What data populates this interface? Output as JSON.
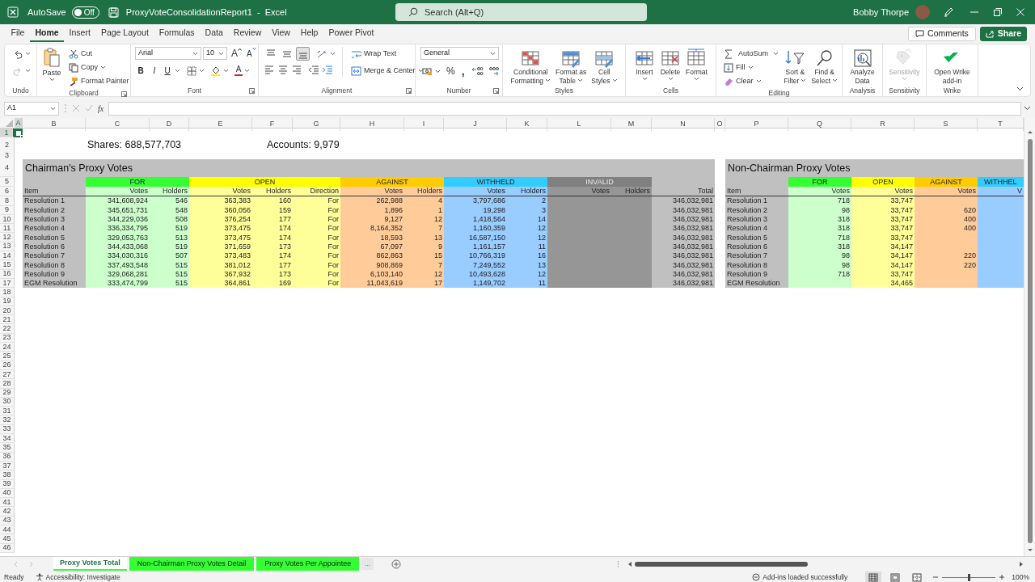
{
  "title_bar": {
    "autosave_label": "AutoSave",
    "autosave_on": false,
    "autosave_state": "Off",
    "document_title": "ProxyVoteConsolidationReport1  -  Excel",
    "search_placeholder": "Search (Alt+Q)",
    "user_name": "Bobby Thorpe"
  },
  "menu_tabs": [
    {
      "label": "File",
      "selected": false
    },
    {
      "label": "Home",
      "selected": true
    },
    {
      "label": "Insert",
      "selected": false
    },
    {
      "label": "Page Layout",
      "selected": false
    },
    {
      "label": "Formulas",
      "selected": false
    },
    {
      "label": "Data",
      "selected": false
    },
    {
      "label": "Review",
      "selected": false
    },
    {
      "label": "View",
      "selected": false
    },
    {
      "label": "Help",
      "selected": false
    },
    {
      "label": "Power Pivot",
      "selected": false
    }
  ],
  "comments_button": "Comments",
  "share_button": "Share",
  "ribbon": {
    "groups": [
      {
        "kind": "undo",
        "label": "Undo"
      },
      {
        "kind": "clipboard",
        "label": "Clipboard",
        "dialog_launcher": true,
        "paste": "Paste",
        "cut": "Cut",
        "copy": "Copy",
        "format_painter": "Format Painter"
      },
      {
        "kind": "font",
        "label": "Font",
        "dialog_launcher": true,
        "font_family": "Arial",
        "font_size": "10",
        "grow_font": "A",
        "shrink_font": "A",
        "bold": "B",
        "italic": "I",
        "underline": "U",
        "font_color": "A"
      },
      {
        "kind": "alignment",
        "label": "Alignment",
        "dialog_launcher": true,
        "vertical_align": [
          {
            "selected": false
          },
          {
            "selected": false
          },
          {
            "selected": true
          }
        ],
        "wrap_text": "Wrap Text",
        "merge": "Merge & Center"
      },
      {
        "kind": "number",
        "label": "Number",
        "dialog_launcher": true,
        "format": "General",
        "percent": "%",
        "comma": ","
      },
      {
        "kind": "styles",
        "label": "Styles",
        "buttons": [
          {
            "lines": [
              "Conditional",
              "Formatting"
            ],
            "menu": true
          },
          {
            "lines": [
              "Format as",
              "Table"
            ],
            "menu": true
          },
          {
            "lines": [
              "Cell",
              "Styles"
            ],
            "menu": true
          }
        ]
      },
      {
        "kind": "cells",
        "label": "Cells",
        "buttons": [
          {
            "lines": [
              "Insert"
            ],
            "menu": true
          },
          {
            "lines": [
              "Delete"
            ],
            "menu": true
          },
          {
            "lines": [
              "Format"
            ],
            "menu": true
          }
        ]
      },
      {
        "kind": "editing",
        "label": "Editing",
        "small_buttons": [
          {
            "label": "AutoSum",
            "menu": true
          },
          {
            "label": "Fill",
            "menu": true
          },
          {
            "label": "Clear",
            "menu": true
          }
        ],
        "buttons": [
          {
            "lines": [
              "Sort &",
              "Filter"
            ],
            "menu": true
          },
          {
            "lines": [
              "Find &",
              "Select"
            ],
            "menu": true
          }
        ]
      },
      {
        "kind": "analysis",
        "label": "Analysis",
        "buttons": [
          {
            "lines": [
              "Analyze",
              "Data"
            ],
            "menu": false
          }
        ]
      },
      {
        "kind": "sensitivity",
        "label": "Sensitivity",
        "buttons": [
          {
            "lines": [
              "Sensitivity"
            ],
            "menu": true,
            "disabled": true
          }
        ]
      },
      {
        "kind": "wrike",
        "label": "Wrike",
        "buttons": [
          {
            "lines": [
              "Open Wrike",
              "add-in"
            ],
            "menu": false
          }
        ]
      }
    ]
  },
  "formula_bar": {
    "name_box": "A1",
    "function_label": "fx"
  },
  "sheet": {
    "columns": [
      {
        "label": "A",
        "selected": true
      },
      {
        "label": "B",
        "selected": false
      },
      {
        "label": "C",
        "selected": false
      },
      {
        "label": "D",
        "selected": false
      },
      {
        "label": "E",
        "selected": false
      },
      {
        "label": "F",
        "selected": false
      },
      {
        "label": "G",
        "selected": false
      },
      {
        "label": "H",
        "selected": false
      },
      {
        "label": "I",
        "selected": false
      },
      {
        "label": "J",
        "selected": false
      },
      {
        "label": "K",
        "selected": false
      },
      {
        "label": "L",
        "selected": false
      },
      {
        "label": "M",
        "selected": false
      },
      {
        "label": "N",
        "selected": false
      },
      {
        "label": "O",
        "selected": false
      },
      {
        "label": "P",
        "selected": false
      },
      {
        "label": "Q",
        "selected": false
      },
      {
        "label": "R",
        "selected": false
      },
      {
        "label": "S",
        "selected": false
      },
      {
        "label": "T",
        "selected": false
      }
    ],
    "shares": "Shares: 688,577,703",
    "accounts": "Accounts: 9,979",
    "rows": [
      {
        "number": "1",
        "kind": "blank",
        "selected": true
      },
      {
        "number": "2",
        "kind": "summary",
        "selected": false
      },
      {
        "number": "3",
        "kind": "spacer",
        "selected": false
      },
      {
        "number": "4",
        "kind": "title",
        "selected": false
      },
      {
        "number": "5",
        "kind": "group_header",
        "selected": false
      },
      {
        "number": "6",
        "kind": "column_header",
        "selected": false
      },
      {
        "number": "8",
        "kind": "data",
        "selected": false
      },
      {
        "number": "9",
        "kind": "data",
        "selected": false
      },
      {
        "number": "10",
        "kind": "data",
        "selected": false
      },
      {
        "number": "11",
        "kind": "data",
        "selected": false
      },
      {
        "number": "12",
        "kind": "data",
        "selected": false
      },
      {
        "number": "13",
        "kind": "data",
        "selected": false
      },
      {
        "number": "14",
        "kind": "data",
        "selected": false
      },
      {
        "number": "15",
        "kind": "data",
        "selected": false
      },
      {
        "number": "16",
        "kind": "data",
        "selected": false
      },
      {
        "number": "17",
        "kind": "data",
        "selected": false
      },
      {
        "number": "18",
        "kind": "blank",
        "selected": false
      },
      {
        "number": "19",
        "kind": "blank",
        "selected": false
      },
      {
        "number": "20",
        "kind": "blank",
        "selected": false
      },
      {
        "number": "21",
        "kind": "blank",
        "selected": false
      },
      {
        "number": "22",
        "kind": "blank",
        "selected": false
      },
      {
        "number": "23",
        "kind": "blank",
        "selected": false
      },
      {
        "number": "24",
        "kind": "blank",
        "selected": false
      },
      {
        "number": "25",
        "kind": "blank",
        "selected": false
      },
      {
        "number": "26",
        "kind": "blank",
        "selected": false
      },
      {
        "number": "27",
        "kind": "blank",
        "selected": false
      },
      {
        "number": "28",
        "kind": "blank",
        "selected": false
      },
      {
        "number": "29",
        "kind": "blank",
        "selected": false
      },
      {
        "number": "30",
        "kind": "blank",
        "selected": false
      },
      {
        "number": "31",
        "kind": "blank",
        "selected": false
      },
      {
        "number": "32",
        "kind": "blank",
        "selected": false
      },
      {
        "number": "33",
        "kind": "blank",
        "selected": false
      },
      {
        "number": "34",
        "kind": "blank",
        "selected": false
      },
      {
        "number": "35",
        "kind": "blank",
        "selected": false
      },
      {
        "number": "36",
        "kind": "blank",
        "selected": false
      },
      {
        "number": "37",
        "kind": "blank",
        "selected": false
      },
      {
        "number": "38",
        "kind": "blank",
        "selected": false
      },
      {
        "number": "39",
        "kind": "blank",
        "selected": false
      },
      {
        "number": "40",
        "kind": "blank",
        "selected": false
      },
      {
        "number": "41",
        "kind": "blank",
        "selected": false
      },
      {
        "number": "42",
        "kind": "blank",
        "selected": false
      },
      {
        "number": "43",
        "kind": "blank",
        "selected": false
      },
      {
        "number": "44",
        "kind": "blank",
        "selected": false
      },
      {
        "number": "45",
        "kind": "blank",
        "selected": false
      },
      {
        "number": "46",
        "kind": "blank",
        "selected": false
      }
    ]
  },
  "chairman_table": {
    "title": "Chairman's Proxy Votes",
    "item_header": "Item",
    "total_header": "Total",
    "groups": [
      {
        "label": "FOR",
        "color": "#33ff33",
        "body": {
          "color": "#ccffcc"
        },
        "columns": [
          "Votes",
          "Holders"
        ]
      },
      {
        "label": "OPEN",
        "color": "#ffff00",
        "body": {
          "color": "#ffff99"
        },
        "columns": [
          "Votes",
          "Holders",
          "Direction"
        ]
      },
      {
        "label": "AGAINST",
        "color": "#ffcc00",
        "body": {
          "color": "#ffcc99"
        },
        "columns": [
          "Votes",
          "Holders"
        ]
      },
      {
        "label": "WITHHELD",
        "color": "#33ccff",
        "body": {
          "color": "#99ccff"
        },
        "columns": [
          "Votes",
          "Holders"
        ]
      },
      {
        "label": "INVALID",
        "color": "#808080",
        "body": {
          "color": "#969696"
        },
        "columns": [
          "Votes",
          "Holders"
        ]
      }
    ],
    "rows": [
      {
        "item": "Resolution 1",
        "values": [
          "341,608,924",
          "546",
          "363,383",
          "160",
          "For",
          "262,988",
          "4",
          "3,797,686",
          "2"
        ],
        "total": "346,032,981"
      },
      {
        "item": "Resolution 2",
        "values": [
          "345,651,731",
          "548",
          "360,056",
          "159",
          "For",
          "1,896",
          "1",
          "19,298",
          "3"
        ],
        "total": "346,032,981"
      },
      {
        "item": "Resolution 3",
        "values": [
          "344,229,036",
          "508",
          "376,254",
          "177",
          "For",
          "9,127",
          "12",
          "1,418,564",
          "14"
        ],
        "total": "346,032,981"
      },
      {
        "item": "Resolution 4",
        "values": [
          "336,334,795",
          "519",
          "373,475",
          "174",
          "For",
          "8,164,352",
          "7",
          "1,160,359",
          "12"
        ],
        "total": "346,032,981"
      },
      {
        "item": "Resolution 5",
        "values": [
          "329,053,763",
          "513",
          "373,475",
          "174",
          "For",
          "18,593",
          "13",
          "16,587,150",
          "12"
        ],
        "total": "346,032,981"
      },
      {
        "item": "Resolution 6",
        "values": [
          "344,433,068",
          "519",
          "371,659",
          "173",
          "For",
          "67,097",
          "9",
          "1,161,157",
          "11"
        ],
        "total": "346,032,981"
      },
      {
        "item": "Resolution 7",
        "values": [
          "334,030,316",
          "507",
          "373,483",
          "174",
          "For",
          "862,863",
          "15",
          "10,766,319",
          "16"
        ],
        "total": "346,032,981"
      },
      {
        "item": "Resolution 8",
        "values": [
          "337,493,548",
          "515",
          "381,012",
          "177",
          "For",
          "908,869",
          "7",
          "7,249,552",
          "13"
        ],
        "total": "346,032,981"
      },
      {
        "item": "Resolution 9",
        "values": [
          "329,068,281",
          "515",
          "367,932",
          "173",
          "For",
          "6,103,140",
          "12",
          "10,493,628",
          "12"
        ],
        "total": "346,032,981"
      },
      {
        "item": "EGM Resolution",
        "values": [
          "333,474,799",
          "515",
          "364,861",
          "169",
          "For",
          "11,043,619",
          "17",
          "1,149,702",
          "11"
        ],
        "total": "346,032,981"
      }
    ]
  },
  "non_chairman_table": {
    "title": "Non-Chairman Proxy Votes",
    "item_header": "Item",
    "groups": [
      {
        "label": "FOR",
        "color": "#33ff33",
        "body": {
          "color": "#ccffcc"
        },
        "columns": [
          "Votes"
        ]
      },
      {
        "label": "OPEN",
        "color": "#ffff00",
        "body": {
          "color": "#ffff99"
        },
        "columns": [
          "Votes"
        ]
      },
      {
        "label": "AGAINST",
        "color": "#ffcc00",
        "body": {
          "color": "#ffcc99"
        },
        "columns": [
          "Votes"
        ]
      },
      {
        "label": "WITHHEL",
        "color": "#33ccff",
        "body": {
          "color": "#99ccff"
        },
        "columns": [
          "V"
        ],
        "truncated": true
      }
    ],
    "rows": [
      {
        "item": "Resolution 1",
        "values": [
          {
            "kind": "number",
            "text": "718"
          },
          {
            "kind": "number",
            "text": "33,747"
          }
        ]
      },
      {
        "item": "Resolution 2",
        "values": [
          {
            "kind": "number",
            "text": "98"
          },
          {
            "kind": "number",
            "text": "33,747"
          },
          {
            "kind": "number",
            "text": "620"
          }
        ]
      },
      {
        "item": "Resolution 3",
        "values": [
          {
            "kind": "number",
            "text": "318"
          },
          {
            "kind": "number",
            "text": "33,747"
          },
          {
            "kind": "number",
            "text": "400"
          }
        ]
      },
      {
        "item": "Resolution 4",
        "values": [
          {
            "kind": "number",
            "text": "318"
          },
          {
            "kind": "number",
            "text": "33,747"
          },
          {
            "kind": "number",
            "text": "400"
          }
        ]
      },
      {
        "item": "Resolution 5",
        "values": [
          {
            "kind": "number",
            "text": "718"
          },
          {
            "kind": "number",
            "text": "33,747"
          }
        ]
      },
      {
        "item": "Resolution 6",
        "values": [
          {
            "kind": "number",
            "text": "318"
          },
          {
            "kind": "number",
            "text": "34,147"
          }
        ]
      },
      {
        "item": "Resolution 7",
        "values": [
          {
            "kind": "number",
            "text": "98"
          },
          {
            "kind": "number",
            "text": "34,147"
          },
          {
            "kind": "number",
            "text": "220"
          }
        ]
      },
      {
        "item": "Resolution 8",
        "values": [
          {
            "kind": "number",
            "text": "98"
          },
          {
            "kind": "number",
            "text": "34,147"
          },
          {
            "kind": "number",
            "text": "220"
          }
        ]
      },
      {
        "item": "Resolution 9",
        "values": [
          {
            "kind": "number",
            "text": "718"
          },
          {
            "kind": "number",
            "text": "33,747"
          }
        ]
      },
      {
        "item": "EGM Resolution",
        "values": [
          {
            "kind": "blank"
          },
          {
            "kind": "number",
            "text": "34,465"
          }
        ]
      }
    ]
  },
  "sheet_tabs": [
    {
      "label": "Proxy Votes Total",
      "selected": true,
      "color": "#33ff33"
    },
    {
      "label": "Non-Chairman Proxy Votes Detail",
      "selected": false,
      "color": "#33ff33"
    },
    {
      "label": "Proxy Votes Per Appointee",
      "selected": false,
      "color": "#33ff33"
    }
  ],
  "more_tabs": "...",
  "status_bar": {
    "ready": "Ready",
    "accessibility": "Accessibility: Investigate",
    "addins": "Add-ins loaded successfully",
    "views": [
      {
        "selected": true
      },
      {
        "selected": false
      },
      {
        "selected": false
      }
    ],
    "zoom": {
      "level": 0.5,
      "reading": "100%"
    }
  }
}
